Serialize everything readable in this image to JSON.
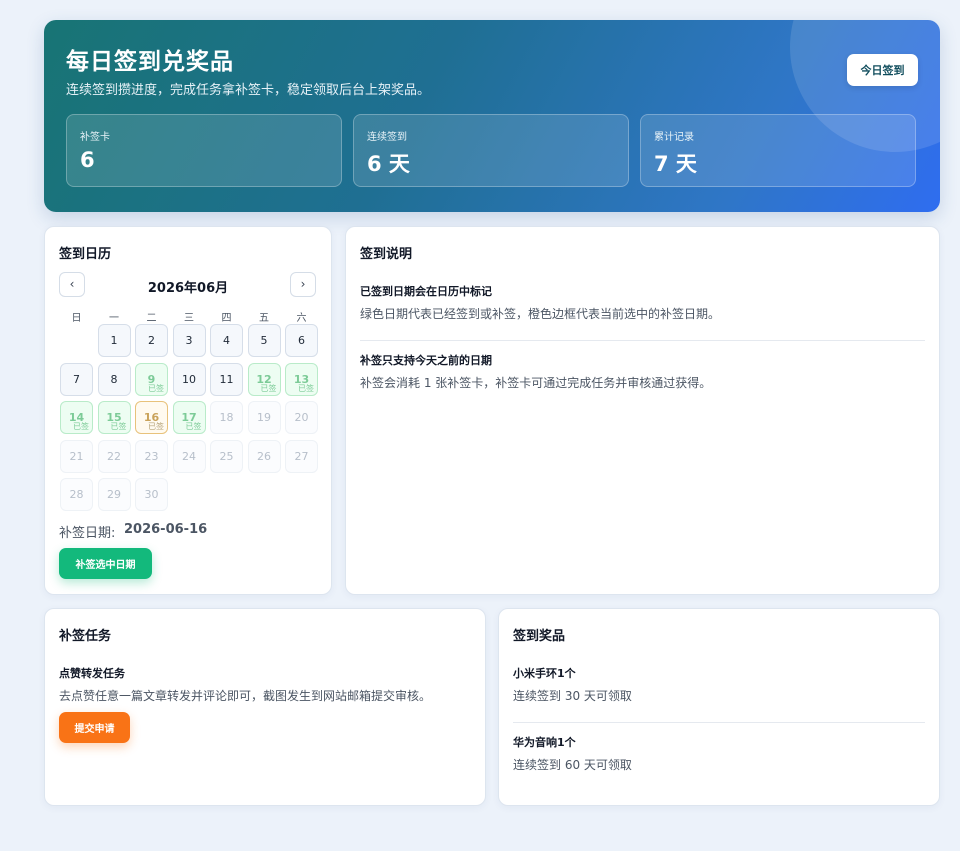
{
  "hero": {
    "title": "每日签到兑奖品",
    "subtitle": "连续签到攒进度，完成任务拿补签卡，稳定领取后台上架奖品。",
    "checkin_button": "今日签到",
    "stats": [
      {
        "label": "补签卡",
        "value": "6"
      },
      {
        "label": "连续签到",
        "value": "6 天"
      },
      {
        "label": "累计记录",
        "value": "7 天"
      }
    ]
  },
  "calendar": {
    "title": "签到日历",
    "month": "2026年06月",
    "prev_label": "‹",
    "next_label": "›",
    "weekdays": [
      "日",
      "一",
      "二",
      "三",
      "四",
      "五",
      "六"
    ],
    "signed_tag": "已签",
    "days": [
      {
        "n": "1",
        "status": "past"
      },
      {
        "n": "2",
        "status": "past"
      },
      {
        "n": "3",
        "status": "past"
      },
      {
        "n": "4",
        "status": "past"
      },
      {
        "n": "5",
        "status": "past"
      },
      {
        "n": "6",
        "status": "past"
      },
      {
        "n": "7",
        "status": "past"
      },
      {
        "n": "8",
        "status": "past"
      },
      {
        "n": "9",
        "status": "signed"
      },
      {
        "n": "10",
        "status": "past"
      },
      {
        "n": "11",
        "status": "past"
      },
      {
        "n": "12",
        "status": "signed"
      },
      {
        "n": "13",
        "status": "signed"
      },
      {
        "n": "14",
        "status": "signed"
      },
      {
        "n": "15",
        "status": "signed"
      },
      {
        "n": "16",
        "status": "selected"
      },
      {
        "n": "17",
        "status": "signed"
      },
      {
        "n": "18",
        "status": "future"
      },
      {
        "n": "19",
        "status": "future"
      },
      {
        "n": "20",
        "status": "future"
      },
      {
        "n": "21",
        "status": "future"
      },
      {
        "n": "22",
        "status": "future"
      },
      {
        "n": "23",
        "status": "future"
      },
      {
        "n": "24",
        "status": "future"
      },
      {
        "n": "25",
        "status": "future"
      },
      {
        "n": "26",
        "status": "future"
      },
      {
        "n": "27",
        "status": "future"
      },
      {
        "n": "28",
        "status": "future"
      },
      {
        "n": "29",
        "status": "future"
      },
      {
        "n": "30",
        "status": "future"
      }
    ],
    "makeup_label": "补签日期:",
    "makeup_date": "2026-06-16",
    "makeup_button": "补签选中日期"
  },
  "rules": {
    "title": "签到说明",
    "items": [
      {
        "heading": "已签到日期会在日历中标记",
        "text": "绿色日期代表已经签到或补签，橙色边框代表当前选中的补签日期。"
      },
      {
        "heading": "补签只支持今天之前的日期",
        "text": "补签会消耗 1 张补签卡，补签卡可通过完成任务并审核通过获得。"
      }
    ]
  },
  "tasks": {
    "title": "补签任务",
    "heading": "点赞转发任务",
    "text": "去点赞任意一篇文章转发并评论即可，截图发生到网站邮箱提交审核。",
    "submit_button": "提交申请"
  },
  "prizes": {
    "title": "签到奖品",
    "items": [
      {
        "name": "小米手环1个",
        "desc": "连续签到 30 天可领取"
      },
      {
        "name": "华为音响1个",
        "desc": "连续签到 60 天可领取"
      }
    ]
  }
}
